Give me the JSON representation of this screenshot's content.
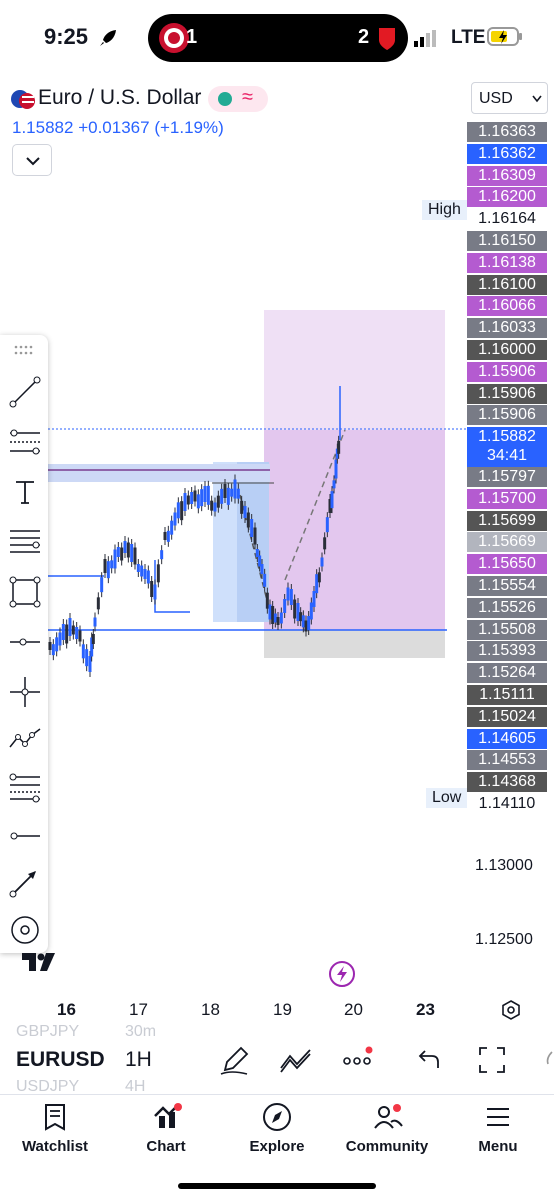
{
  "status_bar": {
    "time": "9:25",
    "left_score": "1",
    "right_score": "2",
    "network": "LTE",
    "icons": [
      "rocket-icon",
      "team-badge-icon",
      "signal-icon",
      "battery-charging-icon"
    ]
  },
  "header": {
    "symbol_title": "Euro / U.S. Dollar",
    "last_price": "1.15882",
    "change": "+0.01367",
    "change_pct": "(+1.19%)",
    "currency": "USD"
  },
  "price_scale": {
    "labels": [
      "1.16363",
      "1.16362",
      "1.16309",
      "1.16200",
      "1.16164",
      "1.16150",
      "1.16138",
      "1.16100",
      "1.16066",
      "1.16033",
      "1.16000",
      "1.15906",
      "1.15906",
      "1.15906",
      "1.15882",
      "1.15797",
      "1.15700",
      "1.15699",
      "1.15669",
      "1.15650",
      "1.15554",
      "1.15526",
      "1.15508",
      "1.15393",
      "1.15264",
      "1.15111",
      "1.15024",
      "1.14605",
      "1.14553",
      "1.14368",
      "1.14110"
    ],
    "countdown": "34:41",
    "high_label": "High",
    "low_label": "Low",
    "axis_ticks": [
      "1.13000",
      "1.12500"
    ],
    "colors": {
      "purple": "#b45bd0",
      "blue": "#2962ff",
      "dark": "#555555",
      "grey": "#787b86",
      "light": "#b2b5be"
    }
  },
  "x_axis": {
    "labels": [
      "16",
      "17",
      "18",
      "19",
      "20",
      "23"
    ]
  },
  "toolbar": {
    "tools": [
      "trend-line-icon",
      "fib-retracement-icon",
      "text-icon",
      "horizontal-lines-icon",
      "rectangle-icon",
      "horizontal-ray-icon",
      "crosshair-icon",
      "pattern-icon",
      "fib-levels-icon",
      "horizontal-line-icon",
      "arrow-icon",
      "eye-icon"
    ]
  },
  "bottom": {
    "symbol": "EURUSD",
    "interval": "1H",
    "ghost_prev_symbol": "GBPJPY",
    "ghost_prev_interval": "30m",
    "ghost_next_symbol": "USDJPY",
    "ghost_next_interval": "4H"
  },
  "tabs": [
    {
      "label": "Watchlist",
      "icon": "watchlist-icon"
    },
    {
      "label": "Chart",
      "icon": "chart-icon"
    },
    {
      "label": "Explore",
      "icon": "compass-icon"
    },
    {
      "label": "Community",
      "icon": "community-icon"
    },
    {
      "label": "Menu",
      "icon": "menu-icon"
    }
  ]
}
